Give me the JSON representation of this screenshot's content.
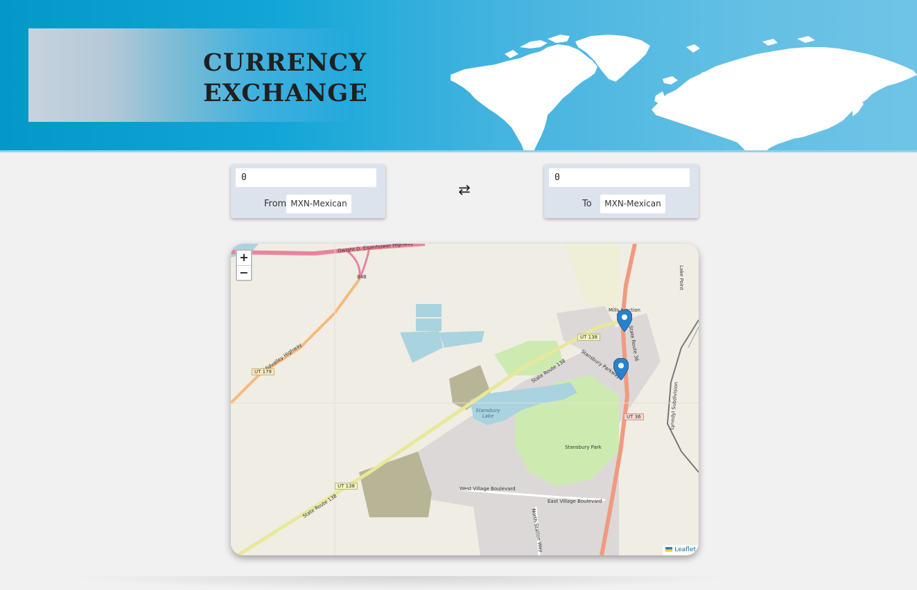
{
  "header": {
    "title_line1": "CURRENCY",
    "title_line2": "EXCHANGE"
  },
  "converter": {
    "from": {
      "amount": "0",
      "label": "From",
      "currency": "MXN-Mexican"
    },
    "to": {
      "amount": "0",
      "label": "To",
      "currency": "MXN-Mexican"
    },
    "swap_icon": "swap-arrows-icon"
  },
  "map": {
    "zoom_in": "+",
    "zoom_out": "−",
    "attribution": "Leaflet",
    "labels": {
      "highway_top_left": "Dwight D. Eisenhower Highway",
      "highway_top": "Dwight D. Eisenhower Highway",
      "exit": "84B",
      "midvalley": "Midvalley Highway",
      "ut179": "UT 179",
      "ut138_a": "UT 138",
      "ut138_b": "UT 138",
      "sr138_a": "State Route 138",
      "sr138_b": "State Route 138",
      "mills": "Mills Junction",
      "sr36": "State Route 36",
      "ut36": "UT 36",
      "stansbury_pkwy": "Stansbury Parkway",
      "lake": "Stansbury Lake",
      "park": "Stansbury Park",
      "west_village": "West Village Boulevard",
      "east_village": "East Village Boulevard",
      "north_station": "North Station Way",
      "lynndyl": "Lynndyl Subdivision",
      "lake_point": "Lake Point"
    }
  }
}
